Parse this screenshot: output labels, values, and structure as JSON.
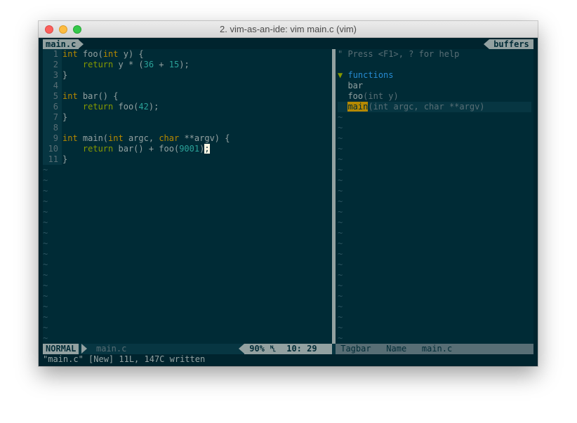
{
  "window": {
    "title": "2. vim-as-an-ide: vim main.c (vim)"
  },
  "tabline": {
    "tab_label": "main.c",
    "buffers_label": "buffers"
  },
  "editor": {
    "line_numbers": [
      "1",
      "2",
      "3",
      "4",
      "5",
      "6",
      "7",
      "8",
      "9",
      "10",
      "11"
    ],
    "tilde": "~",
    "tilde_count_left": 17,
    "cursor_char": ";"
  },
  "tagbar": {
    "help": "\" Press <F1>, ? for help",
    "fold_icon": "▼",
    "group": "functions",
    "tags": [
      {
        "name": "bar",
        "signature": ""
      },
      {
        "name": "foo",
        "signature": "(int y)"
      },
      {
        "name": "main",
        "signature": "(int argc, char **argv)"
      }
    ],
    "tilde_count_right": 22
  },
  "statusline": {
    "mode": "NORMAL",
    "file": "main.c",
    "percent": "90%",
    "line_icon": "␤",
    "position": "10: 29",
    "right_plugin": "Tagbar",
    "right_sort": "Name",
    "right_file": "main.c"
  },
  "cmdline": {
    "message": "\"main.c\" [New] 11L, 147C written"
  },
  "colors": {
    "background": "#002b36",
    "accent_keyword": "#b58900",
    "accent_statement": "#859900",
    "accent_number": "#2aa198",
    "accent_blue": "#268bd2"
  }
}
